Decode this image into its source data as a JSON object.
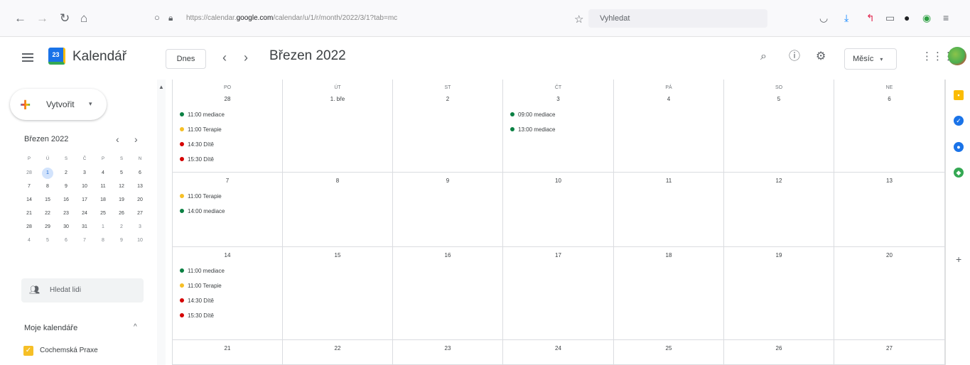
{
  "browser": {
    "url_prefix": "https://calendar.",
    "url_domain": "google.com",
    "url_suffix": "/calendar/u/1/r/month/2022/3/1?tab=mc",
    "search_placeholder": "Vyhledat"
  },
  "header": {
    "app_title": "Kalendář",
    "logo_day": "23",
    "today_label": "Dnes",
    "month_title": "Březen 2022",
    "view_label": "Měsíc"
  },
  "sidebar": {
    "create_label": "Vytvořit",
    "mini_title": "Březen 2022",
    "weekday_headers": [
      "P",
      "Ú",
      "S",
      "Č",
      "P",
      "S",
      "N"
    ],
    "mini_weeks": [
      [
        "28",
        "1",
        "2",
        "3",
        "4",
        "5",
        "6"
      ],
      [
        "7",
        "8",
        "9",
        "10",
        "11",
        "12",
        "13"
      ],
      [
        "14",
        "15",
        "16",
        "17",
        "18",
        "19",
        "20"
      ],
      [
        "21",
        "22",
        "23",
        "24",
        "25",
        "26",
        "27"
      ],
      [
        "28",
        "29",
        "30",
        "31",
        "1",
        "2",
        "3"
      ],
      [
        "4",
        "5",
        "6",
        "7",
        "8",
        "9",
        "10"
      ]
    ],
    "search_people": "Hledat lidi",
    "my_calendars_title": "Moje kalendáře",
    "calendars": [
      {
        "label": "Cochemská Praxe"
      }
    ]
  },
  "calendar": {
    "weekday_headers": [
      "PO",
      "ÚT",
      "ST",
      "ČT",
      "PÁ",
      "SO",
      "NE"
    ],
    "weeks": [
      {
        "days": [
          {
            "num": "28",
            "events": [
              {
                "time": "11:00",
                "title": "mediace",
                "color": "#0b8043"
              },
              {
                "time": "11:00",
                "title": "Terapie",
                "color": "#f6bf26"
              },
              {
                "time": "14:30",
                "title": "Dítě",
                "color": "#d50000"
              },
              {
                "time": "15:30",
                "title": "Dítě",
                "color": "#d50000"
              }
            ]
          },
          {
            "num": "1. bře",
            "events": []
          },
          {
            "num": "2",
            "events": []
          },
          {
            "num": "3",
            "events": [
              {
                "time": "09:00",
                "title": "mediace",
                "color": "#0b8043"
              },
              {
                "time": "13:00",
                "title": "mediace",
                "color": "#0b8043"
              }
            ]
          },
          {
            "num": "4",
            "events": []
          },
          {
            "num": "5",
            "events": []
          },
          {
            "num": "6",
            "events": []
          }
        ]
      },
      {
        "days": [
          {
            "num": "7",
            "events": [
              {
                "time": "11:00",
                "title": "Terapie",
                "color": "#f6bf26"
              },
              {
                "time": "14:00",
                "title": "mediace",
                "color": "#0b8043"
              }
            ]
          },
          {
            "num": "8",
            "events": []
          },
          {
            "num": "9",
            "events": []
          },
          {
            "num": "10",
            "events": []
          },
          {
            "num": "11",
            "events": []
          },
          {
            "num": "12",
            "events": []
          },
          {
            "num": "13",
            "events": []
          }
        ]
      },
      {
        "days": [
          {
            "num": "14",
            "events": [
              {
                "time": "11:00",
                "title": "mediace",
                "color": "#0b8043"
              },
              {
                "time": "11:00",
                "title": "Terapie",
                "color": "#f6bf26"
              },
              {
                "time": "14:30",
                "title": "Dítě",
                "color": "#d50000"
              },
              {
                "time": "15:30",
                "title": "Dítě",
                "color": "#d50000"
              }
            ]
          },
          {
            "num": "15",
            "events": []
          },
          {
            "num": "16",
            "events": []
          },
          {
            "num": "17",
            "events": []
          },
          {
            "num": "18",
            "events": []
          },
          {
            "num": "19",
            "events": []
          },
          {
            "num": "20",
            "events": []
          }
        ]
      },
      {
        "days": [
          {
            "num": "21",
            "events": []
          },
          {
            "num": "22",
            "events": []
          },
          {
            "num": "23",
            "events": []
          },
          {
            "num": "24",
            "events": []
          },
          {
            "num": "25",
            "events": []
          },
          {
            "num": "26",
            "events": []
          },
          {
            "num": "27",
            "events": []
          }
        ]
      }
    ]
  },
  "colors": {
    "accent": "#1a73e8",
    "mediace": "#0b8043",
    "terapie": "#f6bf26",
    "dite": "#d50000"
  },
  "icons": {
    "browser": [
      "back-icon",
      "forward-icon",
      "reload-icon",
      "home-icon",
      "shield-icon",
      "lock-icon",
      "bookmark-star-icon",
      "pocket-icon",
      "download-icon",
      "extension-icon",
      "reader-icon",
      "account-icon",
      "vpn-icon",
      "menu-icon"
    ],
    "header": [
      "hamburger-icon",
      "calendar-logo-icon",
      "search-icon",
      "help-icon",
      "settings-icon",
      "apps-grid-icon",
      "avatar"
    ],
    "rail": [
      "keep-icon",
      "tasks-icon",
      "contacts-icon",
      "maps-icon",
      "add-icon"
    ]
  }
}
